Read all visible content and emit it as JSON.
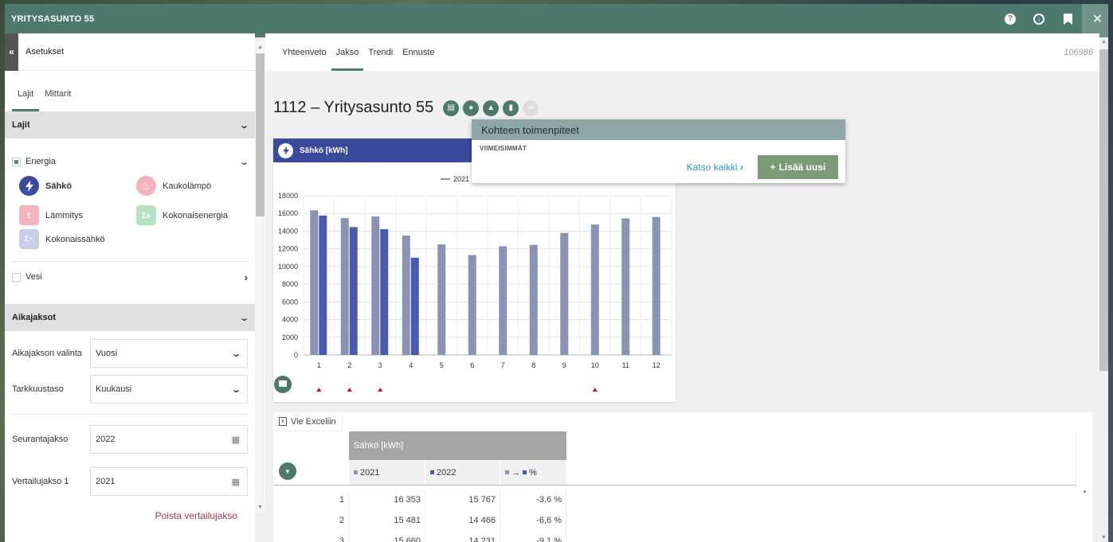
{
  "window": {
    "title": "YRITYSASUNTO 55"
  },
  "titlebar_icons": [
    "help-icon",
    "download-icon",
    "bookmark-icon",
    "close-icon"
  ],
  "sidebar": {
    "header": "Asetukset",
    "tabs": [
      "Lajit",
      "Mittarit"
    ],
    "lajit_heading": "Lajit",
    "energy_label": "Energia",
    "kinds": [
      {
        "label": "Sähkö",
        "icon": "lightning-icon",
        "color": "#3a4a9c"
      },
      {
        "label": "Kaukolämpö",
        "icon": "flame-icon",
        "color": "#f5b3c0"
      },
      {
        "label": "Lämmitys",
        "icon": "heating-icon",
        "color": "#f5b3c0"
      },
      {
        "label": "Kokonaisenergia",
        "icon": "total-energy-icon",
        "color": "#b8e0c4"
      },
      {
        "label": "Kokonaissähkö",
        "icon": "total-electricity-icon",
        "color": "#c8cde8"
      }
    ],
    "vesi_label": "Vesi",
    "aikajaksot_heading": "Aikajaksot",
    "period_label": "Aikajakson valinta",
    "period_value": "Vuosi",
    "precision_label": "Tarkkuustaso",
    "precision_value": "Kuukausi",
    "tracking_label": "Seurantajakso",
    "tracking_value": "2022",
    "compare_label": "Vertailujakso 1",
    "compare_value": "2021",
    "remove_compare": "Poista vertailujakso"
  },
  "main": {
    "tabs": [
      "Yhteenveto",
      "Jakso",
      "Trendi",
      "Ennuste"
    ],
    "active_tab": "Jakso",
    "id": "106986",
    "title": "1112 – Yritysasunto 55"
  },
  "popup": {
    "title": "Kohteen toimenpiteet",
    "subtitle": "VIIMEISIMMÄT",
    "link": "Katso kaikki",
    "button": "Lisää uusi"
  },
  "chart_data": {
    "type": "bar",
    "title": "Sähkö [kWh]",
    "categories": [
      "1",
      "2",
      "3",
      "4",
      "5",
      "6",
      "7",
      "8",
      "9",
      "10",
      "11",
      "12"
    ],
    "series": [
      {
        "name": "2021",
        "color": "#8a93b3",
        "values": [
          16353,
          15481,
          15660,
          13500,
          12500,
          11300,
          12300,
          12450,
          13800,
          14750,
          15450,
          15600
        ]
      },
      {
        "name": "2022",
        "color": "#4a5ab0",
        "values": [
          15767,
          14466,
          14231,
          11000,
          null,
          null,
          null,
          null,
          null,
          null,
          null,
          null
        ]
      }
    ],
    "y_ticks": [
      0,
      2000,
      4000,
      6000,
      8000,
      10000,
      12000,
      14000,
      16000,
      18000
    ],
    "ylim": [
      0,
      18000
    ],
    "legend_visible": "2021",
    "markers_at": [
      "1",
      "2",
      "3",
      "10"
    ]
  },
  "table": {
    "excel_button": "Vie Exceliin",
    "group_header": "Sähkö [kWh]",
    "columns": [
      "2021",
      "2022",
      "%"
    ],
    "rows": [
      {
        "idx": "1",
        "a": "16 353",
        "b": "15 767",
        "p": "-3,6 %"
      },
      {
        "idx": "2",
        "a": "15 481",
        "b": "14 466",
        "p": "-6,6 %"
      },
      {
        "idx": "3",
        "a": "15 660",
        "b": "14 231",
        "p": "-9,1 %"
      }
    ]
  }
}
